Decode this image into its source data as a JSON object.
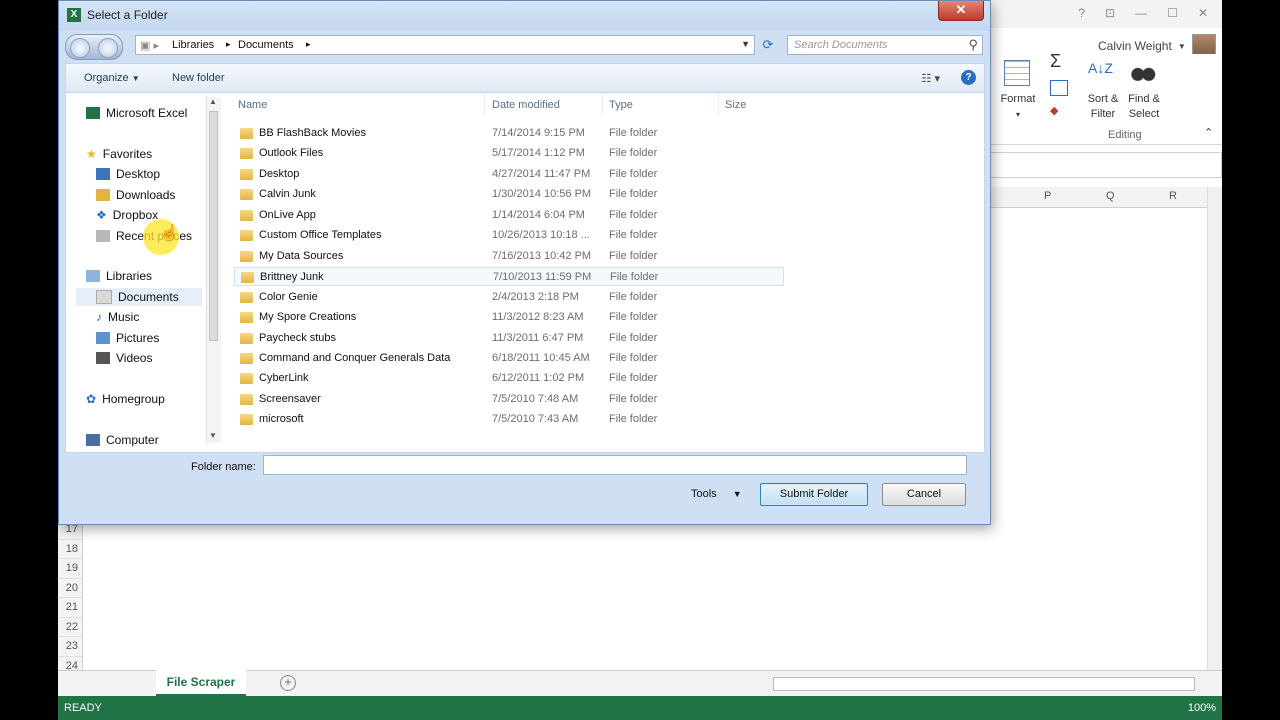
{
  "excel": {
    "user_name": "Calvin Weight",
    "ribbon": {
      "format_label": "Format",
      "sort_filter_label": "Sort & Filter",
      "find_select_label": "Find & Select",
      "editing_label": "Editing",
      "sigma": "Σ"
    },
    "columns": [
      "P",
      "Q",
      "R"
    ],
    "rows": [
      "17",
      "18",
      "19",
      "20",
      "21",
      "22",
      "23",
      "24"
    ],
    "sheet_tab": "File Scraper",
    "status_ready": "READY",
    "zoom": "100%"
  },
  "dialog": {
    "title": "Select a Folder",
    "breadcrumb": [
      "Libraries",
      "Documents"
    ],
    "search_placeholder": "Search Documents",
    "toolbar": {
      "organize": "Organize",
      "new_folder": "New folder"
    },
    "nav": {
      "app": "Microsoft Excel",
      "favorites": "Favorites",
      "fav_items": [
        "Desktop",
        "Downloads",
        "Dropbox",
        "Recent places"
      ],
      "libraries": "Libraries",
      "lib_items": [
        "Documents",
        "Music",
        "Pictures",
        "Videos"
      ],
      "homegroup": "Homegroup",
      "computer": "Computer"
    },
    "columns": {
      "name": "Name",
      "date": "Date modified",
      "type": "Type",
      "size": "Size"
    },
    "items": [
      {
        "name": "BB FlashBack Movies",
        "date": "7/14/2014 9:15 PM",
        "type": "File folder"
      },
      {
        "name": "Outlook Files",
        "date": "5/17/2014 1:12 PM",
        "type": "File folder"
      },
      {
        "name": "Desktop",
        "date": "4/27/2014 11:47 PM",
        "type": "File folder"
      },
      {
        "name": "Calvin Junk",
        "date": "1/30/2014 10:56 PM",
        "type": "File folder"
      },
      {
        "name": "OnLive App",
        "date": "1/14/2014 6:04 PM",
        "type": "File folder"
      },
      {
        "name": "Custom Office Templates",
        "date": "10/26/2013 10:18 ...",
        "type": "File folder"
      },
      {
        "name": "My Data Sources",
        "date": "7/16/2013 10:42 PM",
        "type": "File folder"
      },
      {
        "name": "Brittney Junk",
        "date": "7/10/2013 11:59 PM",
        "type": "File folder"
      },
      {
        "name": "Color Genie",
        "date": "2/4/2013 2:18 PM",
        "type": "File folder"
      },
      {
        "name": "My Spore Creations",
        "date": "11/3/2012 8:23 AM",
        "type": "File folder"
      },
      {
        "name": "Paycheck stubs",
        "date": "11/3/2011 6:47 PM",
        "type": "File folder"
      },
      {
        "name": "Command and Conquer Generals Data",
        "date": "6/18/2011 10:45 AM",
        "type": "File folder"
      },
      {
        "name": "CyberLink",
        "date": "6/12/2011 1:02 PM",
        "type": "File folder"
      },
      {
        "name": "Screensaver",
        "date": "7/5/2010 7:48 AM",
        "type": "File folder"
      },
      {
        "name": "microsoft",
        "date": "7/5/2010 7:43 AM",
        "type": "File folder"
      }
    ],
    "folder_name_label": "Folder name:",
    "folder_name_value": "",
    "tools_label": "Tools",
    "submit_label": "Submit Folder",
    "cancel_label": "Cancel"
  }
}
